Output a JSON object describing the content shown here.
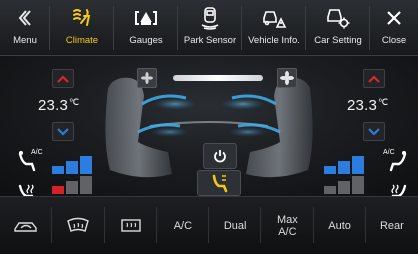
{
  "topbar": {
    "tabs": [
      {
        "id": "menu",
        "label": "Menu",
        "icon": "double-chevron-left-icon"
      },
      {
        "id": "climate",
        "label": "Climate",
        "icon": "climate-fan-icon",
        "active": true
      },
      {
        "id": "gauges",
        "label": "Gauges",
        "icon": "gauges-icon"
      },
      {
        "id": "park",
        "label": "Park Sensor",
        "icon": "park-sensor-icon"
      },
      {
        "id": "vehicle",
        "label": "Vehicle Info.",
        "icon": "vehicle-info-icon"
      },
      {
        "id": "carsetting",
        "label": "Car Setting",
        "icon": "car-setting-icon"
      },
      {
        "id": "close",
        "label": "Close",
        "icon": "close-icon"
      }
    ],
    "active_color": "#f2c81a"
  },
  "climate": {
    "left": {
      "temp_value": "23.3",
      "temp_unit": "℃",
      "ac_label": "A/C",
      "ac_level": 3,
      "ac_max": 3,
      "heat_level": 1,
      "heat_max": 3
    },
    "right": {
      "temp_value": "23.3",
      "temp_unit": "℃",
      "ac_label": "A/C",
      "ac_level": 3,
      "ac_max": 3,
      "heat_level": 0,
      "heat_max": 3
    },
    "fan_speed_fraction": 1.0,
    "colors": {
      "cool": "#2d7de0",
      "heat": "#d4222a",
      "up_arrow": "#d42a2a",
      "down_arrow": "#2e7bd6",
      "inactive": "#606265"
    }
  },
  "bottombar": {
    "buttons": [
      {
        "id": "recirc",
        "label": "",
        "icon": "recirculation-icon"
      },
      {
        "id": "front-defrost",
        "label": "",
        "icon": "front-defrost-icon"
      },
      {
        "id": "rear-defrost",
        "label": "",
        "icon": "rear-defrost-icon"
      },
      {
        "id": "ac",
        "label": "A/C"
      },
      {
        "id": "dual",
        "label": "Dual"
      },
      {
        "id": "maxac",
        "label": "Max\nA/C"
      },
      {
        "id": "auto",
        "label": "Auto"
      },
      {
        "id": "rear",
        "label": "Rear"
      }
    ]
  }
}
